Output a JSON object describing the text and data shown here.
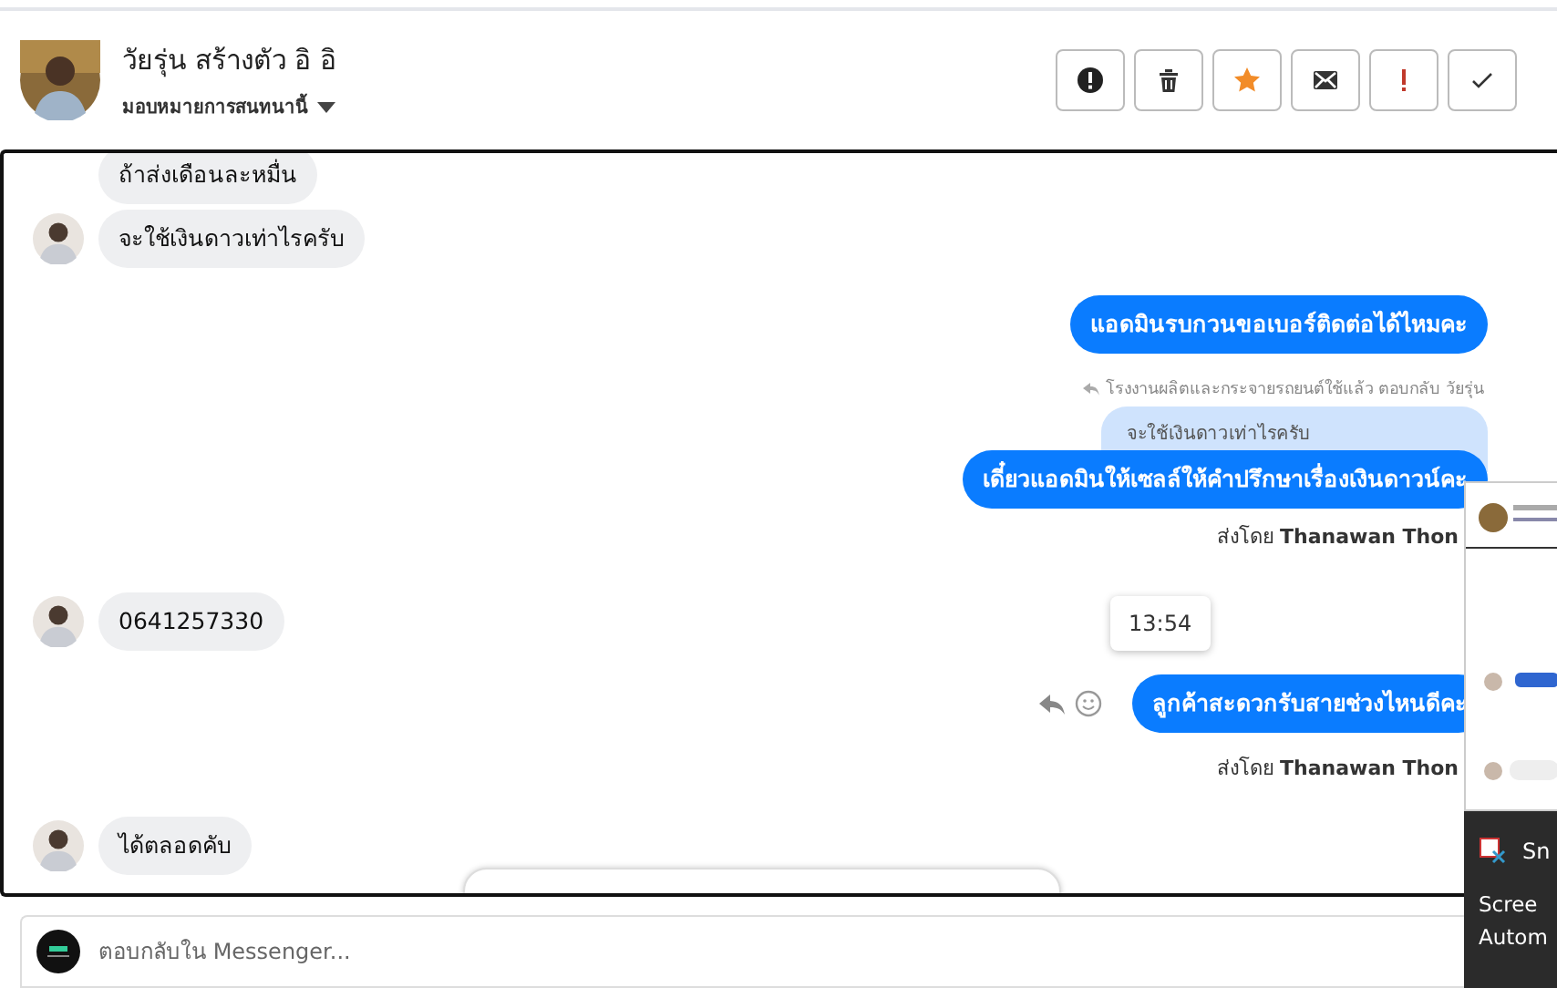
{
  "header": {
    "name": "วัยรุ่น สร้างตัว อิ อิ",
    "assign_label": "มอบหมายการสนทนานี้",
    "actions": [
      {
        "kind": "spam"
      },
      {
        "kind": "delete"
      },
      {
        "kind": "star"
      },
      {
        "kind": "mail"
      },
      {
        "kind": "important"
      },
      {
        "kind": "done"
      }
    ]
  },
  "messages": [
    {
      "kind": "incoming",
      "text": "ถ้าส่งเดือนละหมื่น",
      "avatar": false
    },
    {
      "kind": "incoming",
      "text": "จะใช้เงินดาวเท่าไรครับ",
      "avatar": true
    },
    {
      "kind": "outgoing",
      "text": "แอดมินรบกวนขอเบอร์ติดต่อได้ไหมคะ",
      "hover_actions": false
    },
    {
      "kind": "reply",
      "note": "โรงงานผลิตและกระจายรถยนต์ใช้แล้ว ตอบกลับ วัยรุ่น",
      "quoted": "จะใช้เงินดาวเท่าไรครับ",
      "text": "เดี๋ยวแอดมินให้เซลล์ให้คำปรึกษาเรื่องเงินดาวน์คะ"
    },
    {
      "kind": "sent_by",
      "text": "ส่งโดย **Thanawan Thon**"
    },
    {
      "kind": "incoming",
      "text": "0641257330",
      "avatar": true
    },
    {
      "kind": "outgoing",
      "text": "ลูกค้าสะดวกรับสายช่วงไหนดีคะ",
      "hover_actions": true
    },
    {
      "kind": "sent_by",
      "text": "ส่งโดย **Thanawan Thon**"
    },
    {
      "kind": "incoming",
      "text": "ได้ตลอดคับ",
      "avatar": true
    }
  ],
  "time_tooltip": "13:54",
  "composer": {
    "placeholder": "ตอบกลับใน Messenger..."
  },
  "notification": {
    "app": "Sn",
    "lines": [
      "Scree",
      "Autom"
    ]
  }
}
